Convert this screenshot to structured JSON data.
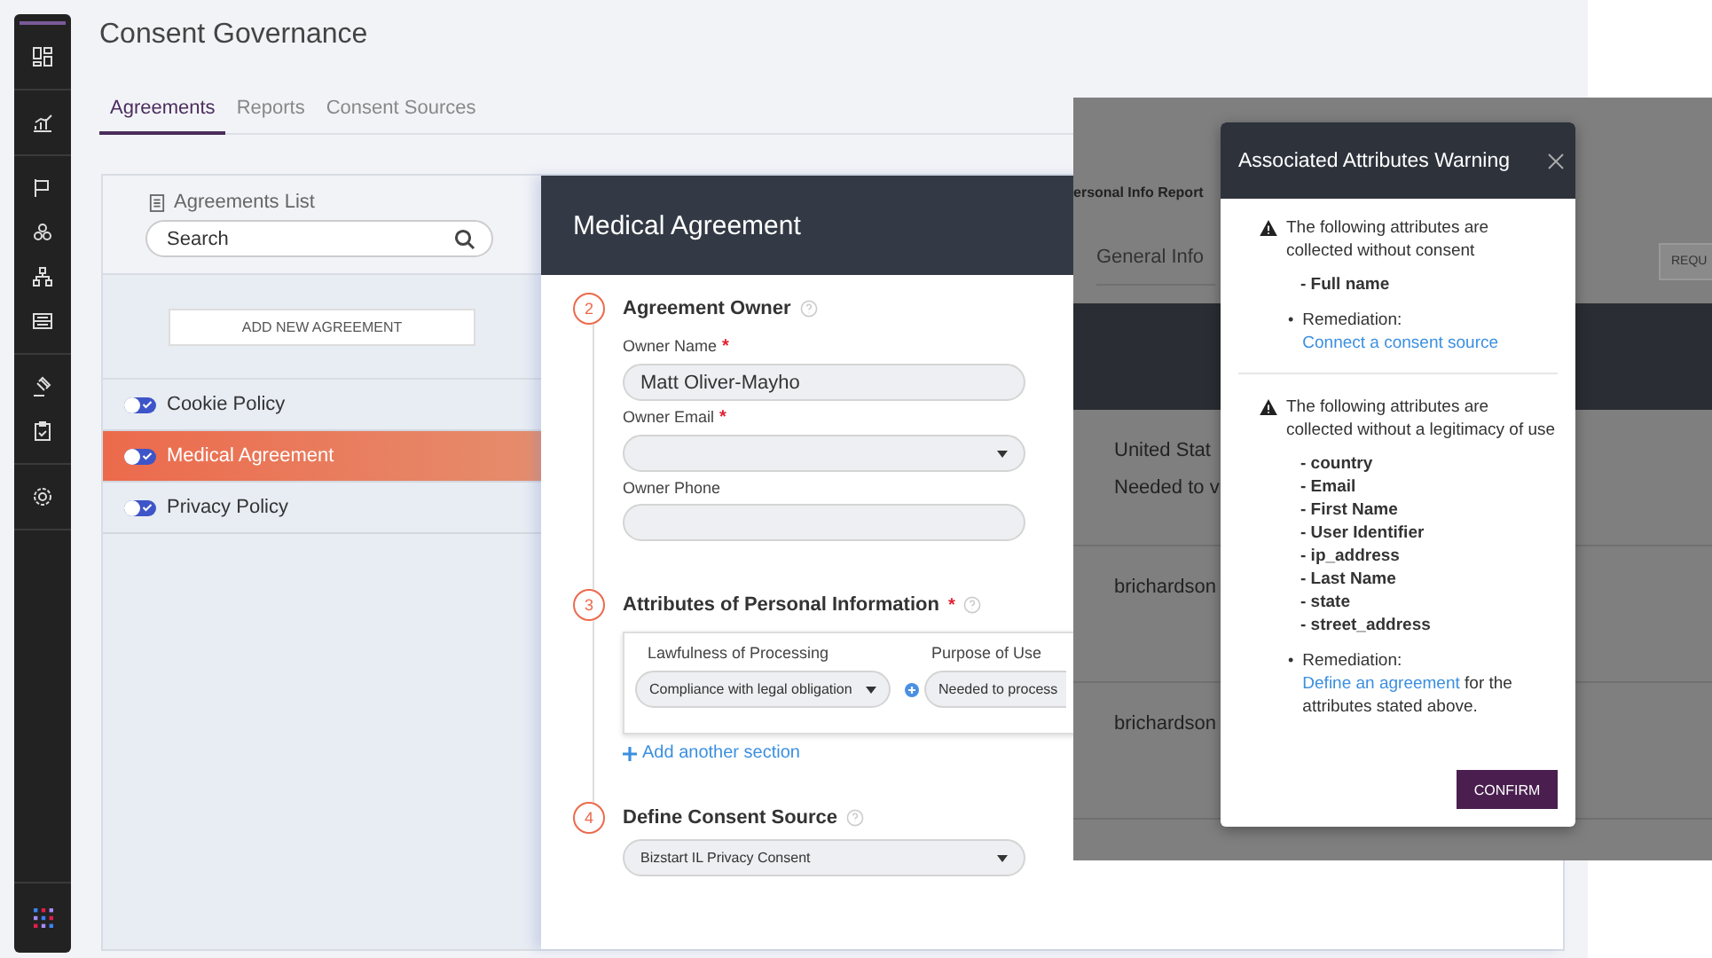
{
  "page_title": "Consent Governance",
  "tabs": [
    {
      "label": "Agreements",
      "selected": true
    },
    {
      "label": "Reports",
      "selected": false
    },
    {
      "label": "Consent Sources",
      "selected": false
    }
  ],
  "agreements_panel": {
    "title": "Agreements List",
    "search": {
      "placeholder": "Search"
    },
    "add_button": "ADD NEW AGREEMENT",
    "items": [
      {
        "name": "Cookie Policy",
        "enabled": true,
        "selected": false
      },
      {
        "name": "Medical Agreement",
        "enabled": true,
        "selected": true
      },
      {
        "name": "Privacy Policy",
        "enabled": true,
        "selected": false
      }
    ]
  },
  "detail": {
    "title": "Medical Agreement",
    "steps": [
      {
        "number": "2",
        "title": "Agreement Owner",
        "kind": "fields",
        "fields": [
          {
            "label": "Owner Name",
            "mark": "*",
            "kind": "text",
            "value": "Matt Oliver-Mayho"
          },
          {
            "label": "Owner Email",
            "mark": "*",
            "kind": "select"
          },
          {
            "label": "Owner Phone",
            "kind": "text"
          }
        ]
      },
      {
        "number": "3",
        "title": "Attributes of Personal Information",
        "mark": "*",
        "kind": "attributes",
        "columns": [
          {
            "label": "Lawfulness of Processing",
            "value": "Compliance with legal obligation"
          },
          {
            "label": "Purpose of Use",
            "value": "Needed to process"
          }
        ],
        "add_link": "Add another section"
      },
      {
        "number": "4",
        "title": "Define Consent Source",
        "kind": "select",
        "value": "Bizstart IL Privacy Consent"
      }
    ]
  },
  "report_window": {
    "title": "ersonal Info Report",
    "tab": "General Info",
    "button": "REQU",
    "rows": [
      {
        "lines": [
          "United Stat",
          "Needed to v"
        ]
      },
      {
        "lines": [
          "brichardson"
        ]
      },
      {
        "lines": [
          "brichardson"
        ]
      }
    ]
  },
  "modal": {
    "title": "Associated Attributes Warning",
    "sections": [
      {
        "message": "The following attributes are collected without consent",
        "attributes": [
          "- Full name"
        ],
        "remediation": {
          "bullet": "•",
          "label": "Remediation:",
          "link": "Connect a consent source"
        }
      },
      {
        "message": "The following attributes are collected without a legitimacy of use",
        "attributes": [
          "- country",
          "- Email",
          "- First Name",
          "- User Identifier",
          "- ip_address",
          "- Last Name",
          "- state",
          "- street_address"
        ],
        "remediation": {
          "bullet": "•",
          "label": "Remediation:",
          "link": "Define an agreement",
          "suffix": "for the attributes stated above."
        }
      }
    ],
    "confirm": "CONFIRM"
  }
}
